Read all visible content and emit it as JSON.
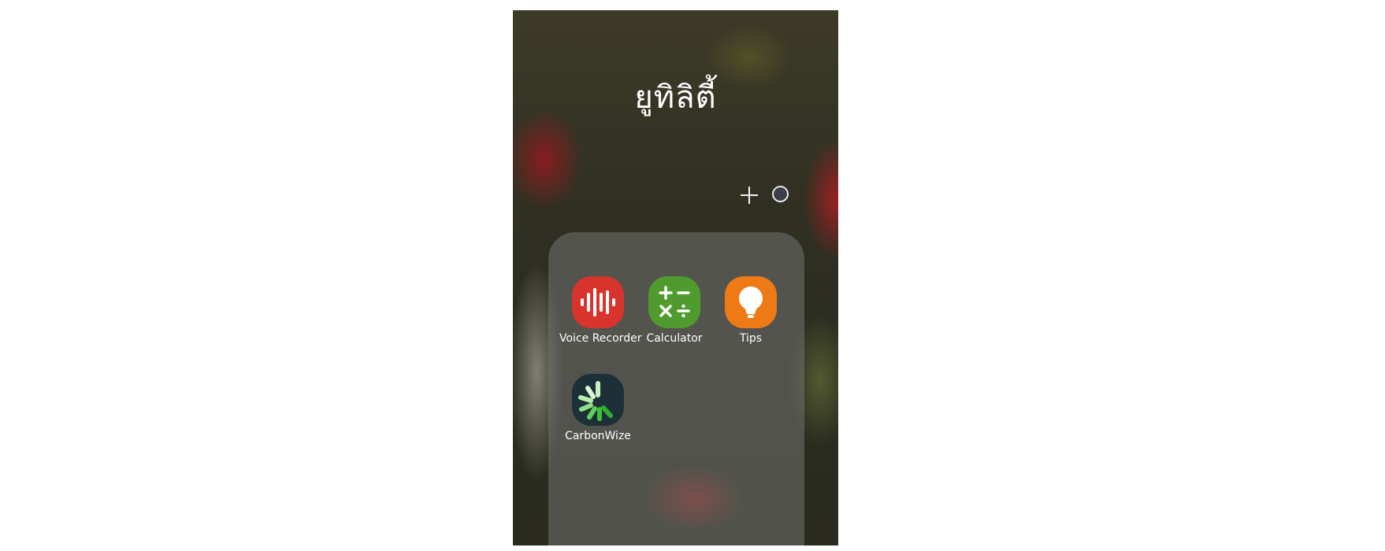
{
  "folder": {
    "title": "ยูทิลิตี้",
    "add_icon": "plus-icon",
    "color_icon": "circle-color-icon"
  },
  "apps": [
    {
      "label": "Voice Recorder",
      "icon": "voice-recorder-icon",
      "color": "#d8332c"
    },
    {
      "label": "Calculator",
      "icon": "calculator-icon",
      "color": "#4f9b2d"
    },
    {
      "label": "Tips",
      "icon": "lightbulb-icon",
      "color": "#ee7a16"
    },
    {
      "label": "CarbonWize",
      "icon": "carbonwize-icon",
      "color": "#1d3038"
    }
  ]
}
